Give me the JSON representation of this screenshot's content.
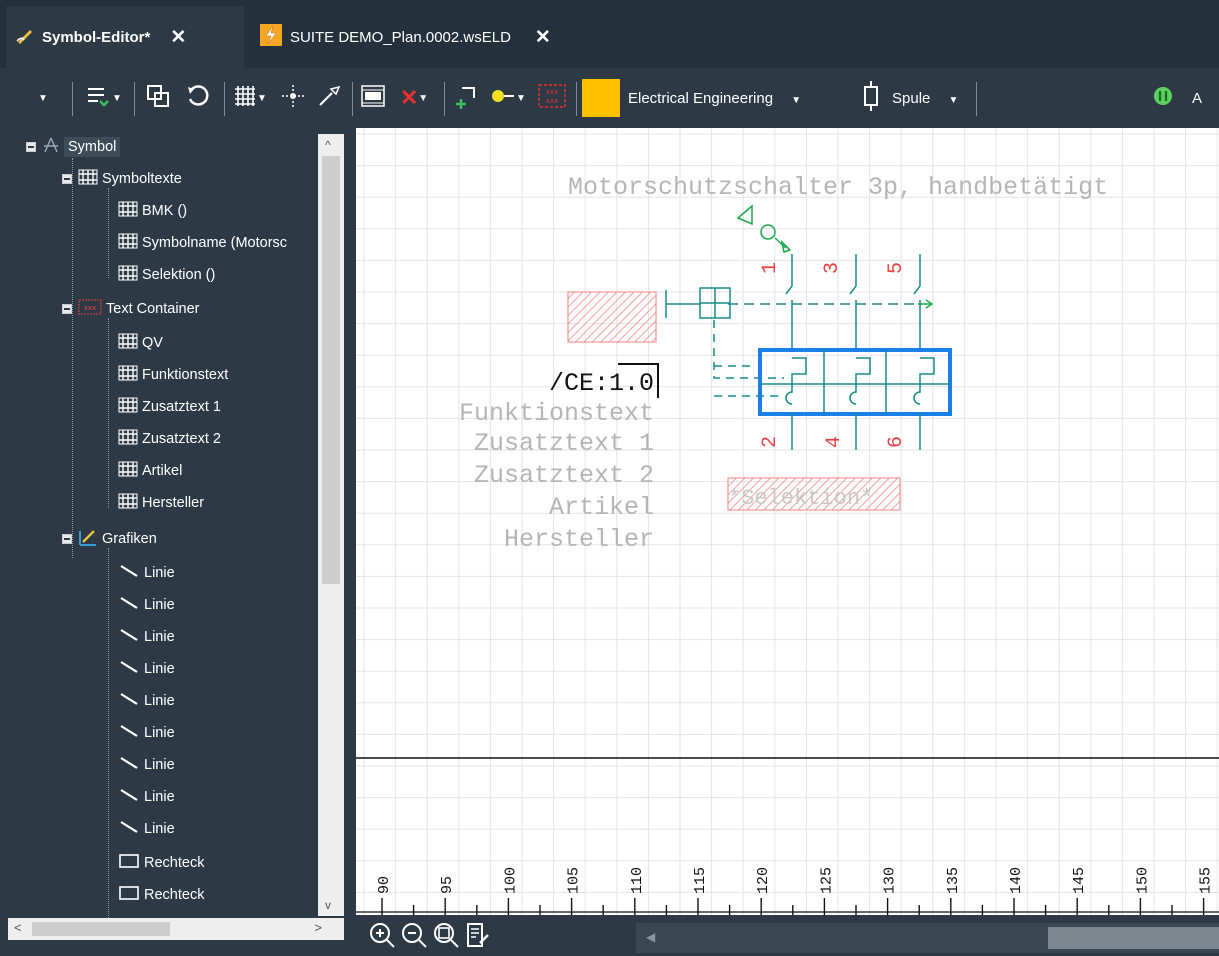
{
  "tabs": [
    {
      "label": "Symbol-Editor*",
      "close": "✕"
    },
    {
      "label": "SUITE DEMO_Plan.0002.wsELD",
      "close": "✕"
    }
  ],
  "toolbar": {
    "discipline": "Electrical Engineering",
    "symbol_type": "Spule",
    "trailing_label": "A",
    "color_swatch": "#FFC000"
  },
  "tree": {
    "root": "Symbol",
    "symboltexte": {
      "label": "Symboltexte",
      "items": [
        "BMK ()",
        "Symbolname (Motorsc",
        "Selektion ()"
      ]
    },
    "textcontainer": {
      "label": "Text Container",
      "items": [
        "QV",
        "Funktionstext",
        "Zusatztext 1",
        "Zusatztext 2",
        "Artikel",
        "Hersteller"
      ]
    },
    "grafiken": {
      "label": "Grafiken",
      "items": [
        "Linie",
        "Linie",
        "Linie",
        "Linie",
        "Linie",
        "Linie",
        "Linie",
        "Linie",
        "Linie",
        "Rechteck",
        "Rechteck"
      ]
    }
  },
  "canvas": {
    "title": "Motorschutzschalter 3p, handbetätigt",
    "qv": "/CE:1.0",
    "text_container": [
      "Funktionstext",
      "Zusatztext 1",
      "Zusatztext 2",
      "Artikel",
      "Hersteller"
    ],
    "selektion": "*Selektion*",
    "terminals_top": [
      "1",
      "3",
      "5"
    ],
    "terminals_bottom": [
      "2",
      "4",
      "6"
    ],
    "ruler": [
      "90",
      "95",
      "100",
      "105",
      "110",
      "115",
      "120",
      "125",
      "130",
      "135",
      "140",
      "145",
      "150",
      "155"
    ]
  },
  "colors": {
    "accent_selection": "#1a7fe6",
    "symbol_red": "#e84040",
    "symbol_green": "#1aa84a",
    "symbol_teal": "#188a8a",
    "tab_active_icon": "#f5a623"
  }
}
